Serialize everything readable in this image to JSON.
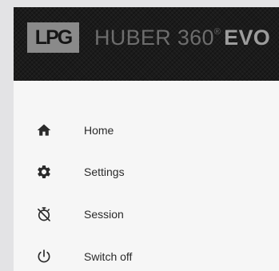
{
  "header": {
    "logo_text": "LPG",
    "product_name": "HUBER 360",
    "registered_mark": "®",
    "product_suffix": "EVO"
  },
  "menu": {
    "items": [
      {
        "label": "Home",
        "icon": "home-icon"
      },
      {
        "label": "Settings",
        "icon": "gear-icon"
      },
      {
        "label": "Session",
        "icon": "timer-off-icon"
      },
      {
        "label": "Switch off",
        "icon": "power-icon"
      }
    ]
  },
  "colors": {
    "header_bg": "#1b1b1b",
    "drawer_bg": "#f6f6f6",
    "page_bg": "#e3e3e5",
    "icon": "#2b2b2b",
    "text": "#2a2a2a"
  }
}
